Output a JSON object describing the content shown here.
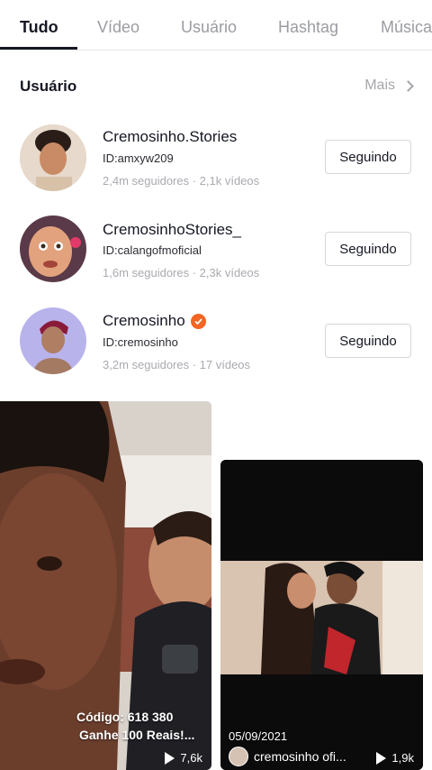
{
  "tabs": [
    {
      "label": "Tudo",
      "active": true
    },
    {
      "label": "Vídeo"
    },
    {
      "label": "Usuário"
    },
    {
      "label": "Hashtag"
    },
    {
      "label": "Música"
    }
  ],
  "section": {
    "title": "Usuário",
    "more": "Mais"
  },
  "users": [
    {
      "name": "Cremosinho.Stories",
      "id": "ID:amxyw209",
      "stats": "2,4m seguidores · 2,1k  vídeos",
      "button": "Seguindo",
      "verified": false
    },
    {
      "name": "CremosinhoStories_",
      "id": "ID:calangofmoficial",
      "stats": "1,6m seguidores · 2,3k  vídeos",
      "button": "Seguindo",
      "verified": false
    },
    {
      "name": "Cremosinho",
      "id": "ID:cremosinho",
      "stats": "3,2m seguidores · 17  vídeos",
      "button": "Seguindo",
      "verified": true
    }
  ],
  "videos": [
    {
      "caption_line1": "Código: 618 380",
      "caption_line2": "Ganhe 100 Reais!...",
      "views": "7,6k"
    },
    {
      "date": "05/09/2021",
      "author": "cremosinho ofi...",
      "views": "1,9k"
    }
  ],
  "colors": {
    "verified": "#f26522",
    "muted": "#a9aab0",
    "text": "#161823"
  }
}
